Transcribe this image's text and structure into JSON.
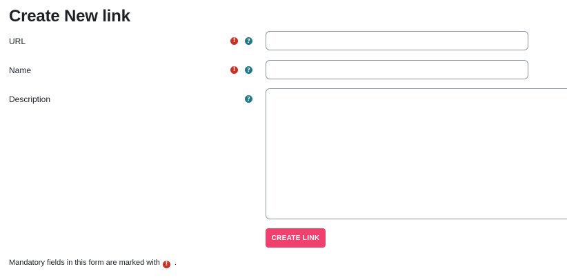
{
  "form": {
    "title": "Create New link",
    "fields": [
      {
        "label": "URL",
        "required": true,
        "has_help": true,
        "value": "",
        "placeholder": ""
      },
      {
        "label": "Name",
        "required": true,
        "has_help": true,
        "value": "",
        "placeholder": ""
      },
      {
        "label": "Description",
        "required": false,
        "has_help": true,
        "value": "",
        "placeholder": ""
      }
    ],
    "submit_label": "CREATE LINK",
    "mandatory_note_prefix": "Mandatory fields in this form are marked with",
    "mandatory_note_suffix": "."
  },
  "icons": {
    "required": "exclamation-circle-icon",
    "help": "question-circle-icon"
  },
  "colors": {
    "required_icon": "#ca3120",
    "help_icon": "#1f7a8c",
    "submit_button": "#f0406d",
    "input_border": "#8f959e",
    "text": "#1d2125"
  }
}
